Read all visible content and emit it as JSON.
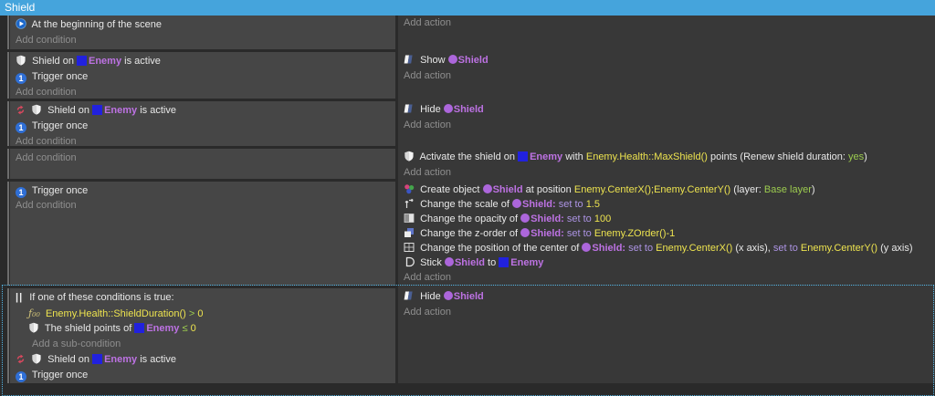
{
  "window": {
    "title": "Shield"
  },
  "labels": {
    "add_condition": "Add condition",
    "add_action": "Add action",
    "trigger_once": "Trigger once",
    "add_sub_condition": "Add a sub-condition"
  },
  "icons": {
    "trigger_digit": "1",
    "or": "||",
    "fx": "ƒ₀₀"
  },
  "objects": {
    "shield": "Shield",
    "shield_colon": "Shield:",
    "enemy": "Enemy"
  },
  "colors": {
    "titlebar_blue": "#45A4DC",
    "condition_bg": "#464646",
    "action_bg": "#383838",
    "object_purple": "#BD72E3",
    "expression_yellow": "#EDE34F",
    "operator_violet": "#AC93E3",
    "green": "#9CCB4F",
    "enemy_icon_blue": "#2121DE",
    "shield_icon_purple": "#AC66DB",
    "selection_blue": "#55B8E8"
  },
  "events": {
    "e1": {
      "condition": "At the beginning of the scene"
    },
    "e2": {
      "cond_pre": "Shield on",
      "cond_post": "is active",
      "action_verb": "Show"
    },
    "e3": {
      "cond_pre": "Shield on",
      "cond_post": "is active",
      "action_verb": "Hide"
    },
    "e4": {
      "a1": {
        "pre": "Activate the shield on",
        "mid": "with",
        "expr": "Enemy.Health::MaxShield()",
        "post": "points (Renew shield duration:",
        "flag": "yes",
        "close": ")"
      }
    },
    "e5": {
      "a1": {
        "pre": "Create object",
        "mid": "at position",
        "expr": "Enemy.CenterX();Enemy.CenterY()",
        "layer_label": "(layer:",
        "layer": "Base layer",
        "close": ")"
      },
      "a2": {
        "pre": "Change the scale of",
        "op": "set to",
        "val": "1.5"
      },
      "a3": {
        "pre": "Change the opacity of",
        "op": "set to",
        "val": "100"
      },
      "a4": {
        "pre": "Change the z-order of",
        "op": "set to",
        "val": "Enemy.ZOrder()-1"
      },
      "a5": {
        "pre": "Change the position of the center of",
        "op1": "set to",
        "val1": "Enemy.CenterX()",
        "xaxis": "(x axis),",
        "op2": "set to",
        "val2": "Enemy.CenterY()",
        "yaxis": "(y axis)"
      },
      "a6": {
        "pre": "Stick",
        "mid": "to"
      }
    },
    "e6": {
      "or_header": "If one of these conditions is true:",
      "sub1": {
        "expr": "Enemy.Health::ShieldDuration()",
        "cmp": ">",
        "val": "0"
      },
      "sub2": {
        "pre": "The shield points of",
        "cmp": "≤",
        "val": "0"
      },
      "cond2_pre": "Shield on",
      "cond2_post": "is active",
      "action_verb": "Hide"
    }
  }
}
